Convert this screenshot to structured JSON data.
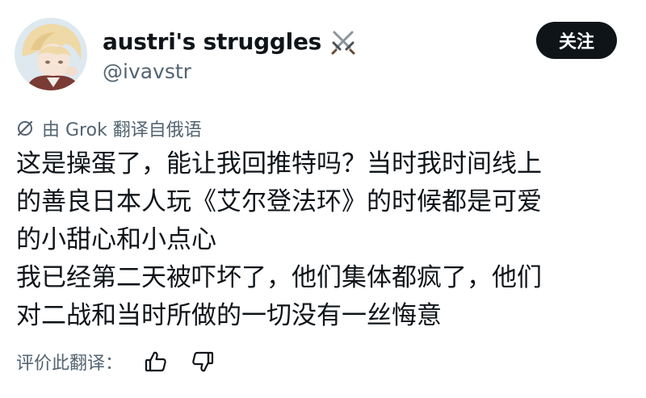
{
  "author": {
    "display_name": "austri's struggles",
    "handle": "@ivavstr",
    "badge_icon": "crossed-swords-icon"
  },
  "actions": {
    "follow_label": "关注"
  },
  "translation": {
    "note": "由 Grok 翻译自俄语",
    "icon": "grok-icon"
  },
  "tweet": {
    "lines": [
      "这是操蛋了，能让我回推特吗？当时我时间线上",
      "的善良日本人玩《艾尔登法环》的时候都是可爱",
      "的小甜心和小点心",
      "我已经第二天被吓坏了，他们集体都疯了，他们",
      "对二战和当时所做的一切没有一丝悔意"
    ]
  },
  "rating": {
    "label": "评价此翻译：",
    "thumbs_up_icon": "thumbs-up-icon",
    "thumbs_down_icon": "thumbs-down-icon"
  },
  "colors": {
    "text_primary": "#0f1419",
    "text_secondary": "#536471",
    "button_bg": "#0f1419",
    "button_text": "#ffffff"
  }
}
